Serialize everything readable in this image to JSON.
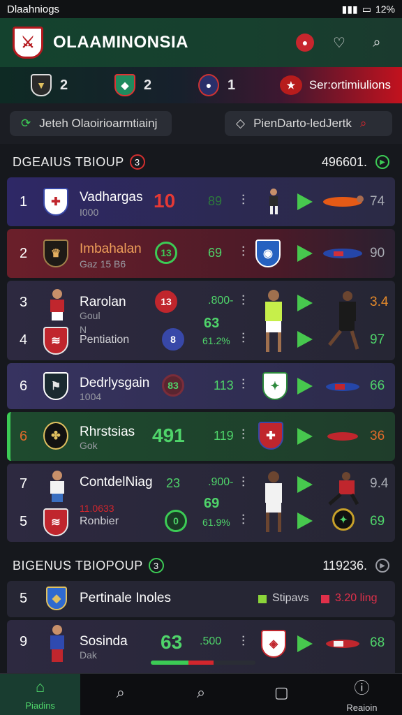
{
  "status": {
    "carrier": "Dlaahniogs",
    "battery": "12%"
  },
  "header": {
    "title": "OLAAMINONSIA"
  },
  "scorebar": {
    "items": [
      {
        "score": "2",
        "crest_color": "#2a2a2a"
      },
      {
        "score": "2",
        "crest_color": "#1f8b5e"
      },
      {
        "score": "1",
        "crest_color": "#2a2f6a"
      }
    ],
    "button_label": "Ser:ortimiulions"
  },
  "filters": {
    "left_label": "Jeteh Olaoirioarmtiainj",
    "right_label": "PienDarto-ledJertk"
  },
  "section1": {
    "title": "DGEAIUS TBIOUP",
    "badge": "3",
    "right_value": "496601."
  },
  "section2": {
    "title": "BIGENUS TBIOPOUP",
    "badge": "3",
    "right_value": "119236."
  },
  "rows": [
    {
      "rank": "1",
      "name": "Vadhargas",
      "sub": "I000",
      "score": "10",
      "stat": "89",
      "end": "74"
    },
    {
      "rank": "2",
      "name": "Imbahalan",
      "sub": "Gaz 15 B6",
      "ring": "13",
      "stat": "69",
      "end": "90"
    },
    {
      "rank": "3",
      "name": "Rarolan",
      "sub": "Goul",
      "ring": "13",
      "stat": ".800-",
      "end": "3.4"
    },
    {
      "rank": "4",
      "name": "Pentiation",
      "sub": "N",
      "ring": "8",
      "stat": "61.2%",
      "big_stat": "63",
      "end": "97"
    },
    {
      "rank": "6",
      "name": "Dedrlysgain",
      "sub": "1004",
      "ring": "83",
      "stat": "113",
      "end": "66"
    },
    {
      "rank": "6",
      "name": "Rhrstsias",
      "sub": "Gok",
      "score": "491",
      "stat": "119",
      "end": "36"
    },
    {
      "rank": "7",
      "name": "ContdelNiag",
      "sub": "11.0633",
      "ring_text": "23",
      "stat": ".900-",
      "end": "9.4"
    },
    {
      "rank": "5",
      "name": "Ronbier",
      "sub": "",
      "ring": "0",
      "stat": "61.9%",
      "big_stat": "69",
      "end": "69"
    }
  ],
  "row_p": {
    "rank": "5",
    "name": "Pertinale Inoles",
    "legend_a": "Stipavs",
    "legend_b": "3.20 ling"
  },
  "row_last": {
    "rank": "9",
    "name": "Sosinda",
    "sub": "Dak",
    "score": "63",
    "stat": ".500",
    "end": "68"
  },
  "progress": 0.6,
  "tabs": [
    {
      "label": "Piadins",
      "icon": "home-icon"
    },
    {
      "label": "",
      "icon": "search-icon"
    },
    {
      "label": "",
      "icon": "search-icon"
    },
    {
      "label": "",
      "icon": "square-icon"
    },
    {
      "label": "Reaioin",
      "icon": "info-icon"
    }
  ]
}
